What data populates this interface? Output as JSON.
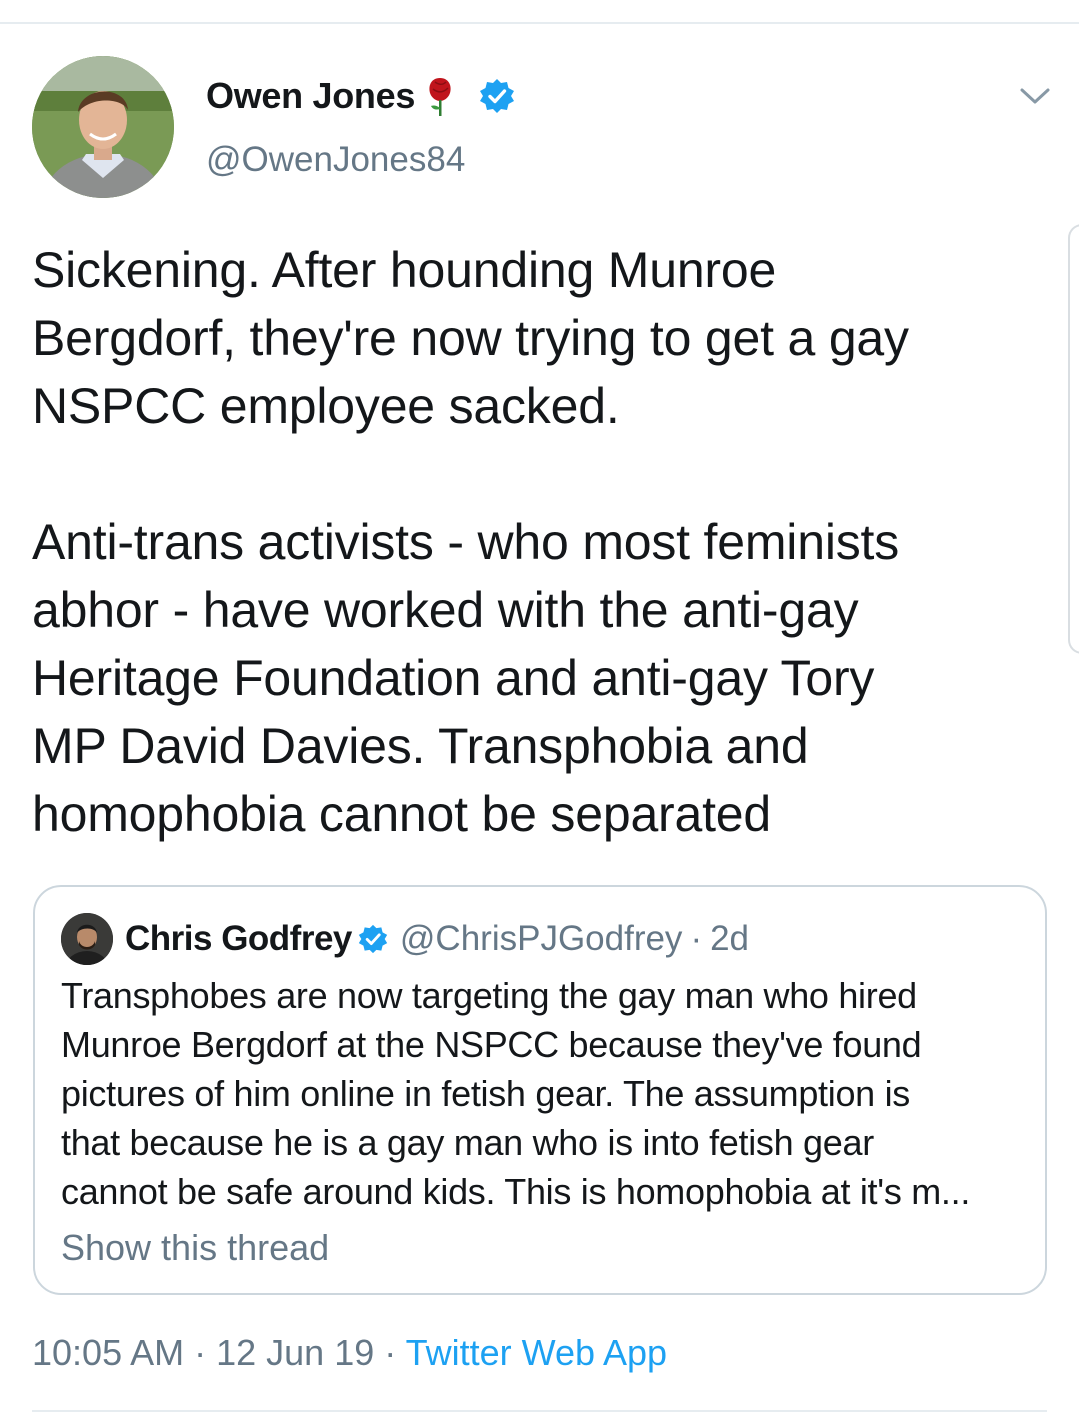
{
  "tweet": {
    "author": {
      "name": "Owen Jones",
      "handle": "@OwenJones84",
      "verified": true,
      "emoji_icon": "rose-icon"
    },
    "text_paragraphs": [
      "Sickening. After hounding Munroe\nBergdorf, they're now trying to get a gay\nNSPCC employee sacked.",
      "Anti-trans activists - who most feminists\nabhor - have worked with the anti-gay\nHeritage Foundation and anti-gay Tory\nMP David Davies. Transphobia and\nhomophobia cannot be separated"
    ],
    "quoted": {
      "name": "Chris Godfrey",
      "handle": "@ChrisPJGodfrey",
      "separator": "·",
      "time": "2d",
      "verified": true,
      "text_lines": [
        "Transphobes are now targeting the gay man who hired",
        "Munroe Bergdorf at the NSPCC because they've found",
        "pictures of him online in fetish gear.  The assumption is",
        "that because he is a gay man who is into fetish gear",
        "cannot be safe around kids. This is homophobia at it's m..."
      ],
      "show_thread": "Show this thread"
    },
    "meta": {
      "time": "10:05 AM",
      "sep1": " · ",
      "date": "12 Jun 19",
      "sep2": " · ",
      "source": "Twitter Web App"
    }
  },
  "colors": {
    "text": "#14171a",
    "secondary": "#657786",
    "link": "#1da1f2",
    "verified": "#1da1f2",
    "border": "#ccd6dd",
    "rose": "#c0141c"
  }
}
